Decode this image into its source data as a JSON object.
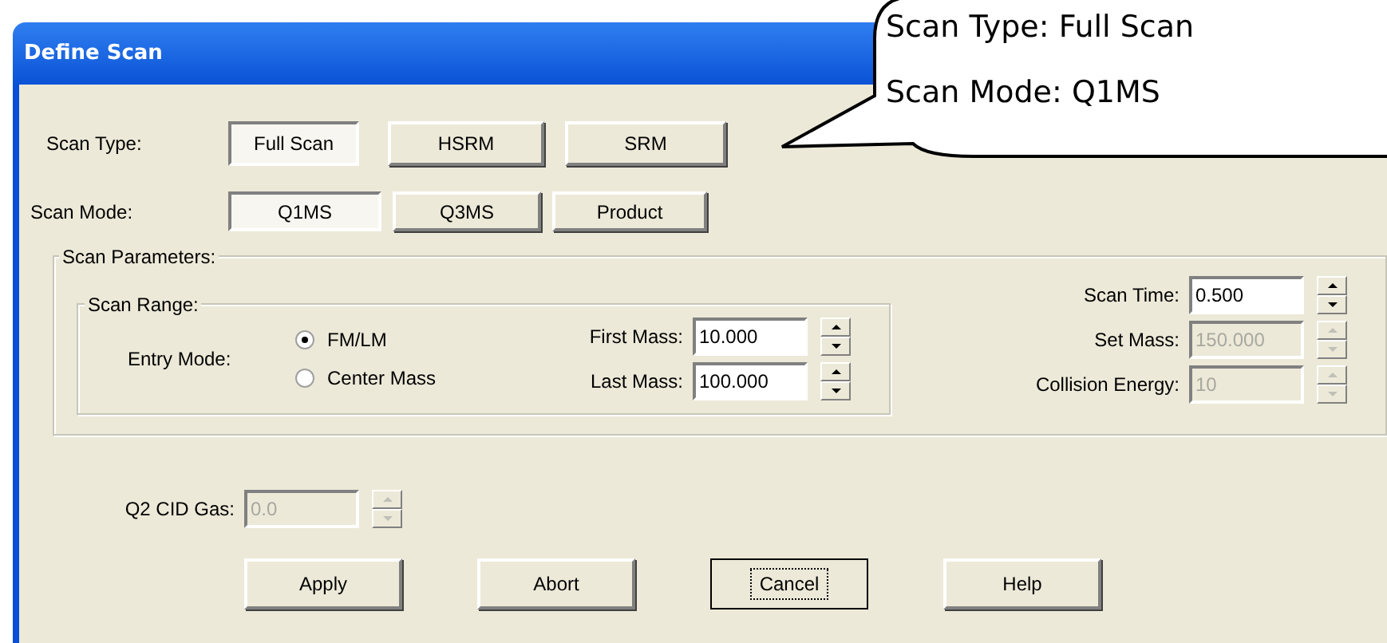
{
  "window": {
    "title": "Define Scan"
  },
  "scan_type": {
    "label": "Scan Type:",
    "options": [
      {
        "label": "Full Scan",
        "selected": true
      },
      {
        "label": "HSRM",
        "selected": false
      },
      {
        "label": "SRM",
        "selected": false
      }
    ]
  },
  "scan_mode": {
    "label": "Scan Mode:",
    "options": [
      {
        "label": "Q1MS",
        "selected": true
      },
      {
        "label": "Q3MS",
        "selected": false
      },
      {
        "label": "Product",
        "selected": false
      }
    ]
  },
  "scan_parameters": {
    "title": "Scan Parameters:",
    "scan_range": {
      "title": "Scan Range:",
      "entry_mode": {
        "label": "Entry Mode:",
        "options": [
          {
            "label": "FM/LM",
            "selected": true
          },
          {
            "label": "Center Mass",
            "selected": false
          }
        ]
      },
      "fields": [
        {
          "label": "First Mass:",
          "value": "10.000",
          "disabled": false
        },
        {
          "label": "Last Mass:",
          "value": "100.000",
          "disabled": false
        }
      ]
    },
    "fields": [
      {
        "label": "Scan Time:",
        "value": "0.500",
        "disabled": false
      },
      {
        "label": "Set Mass:",
        "value": "150.000",
        "disabled": true
      },
      {
        "label": "Collision Energy:",
        "value": "10",
        "disabled": true
      }
    ]
  },
  "q2_cid_gas": {
    "label": "Q2 CID Gas:",
    "value": "0.0",
    "disabled": true
  },
  "buttons": [
    {
      "label": "Apply",
      "focused": false
    },
    {
      "label": "Abort",
      "focused": false
    },
    {
      "label": "Cancel",
      "focused": true
    },
    {
      "label": "Help",
      "focused": false
    }
  ],
  "callout": {
    "lines": [
      "Scan Type: Full Scan",
      "Scan Mode: Q1MS"
    ]
  }
}
